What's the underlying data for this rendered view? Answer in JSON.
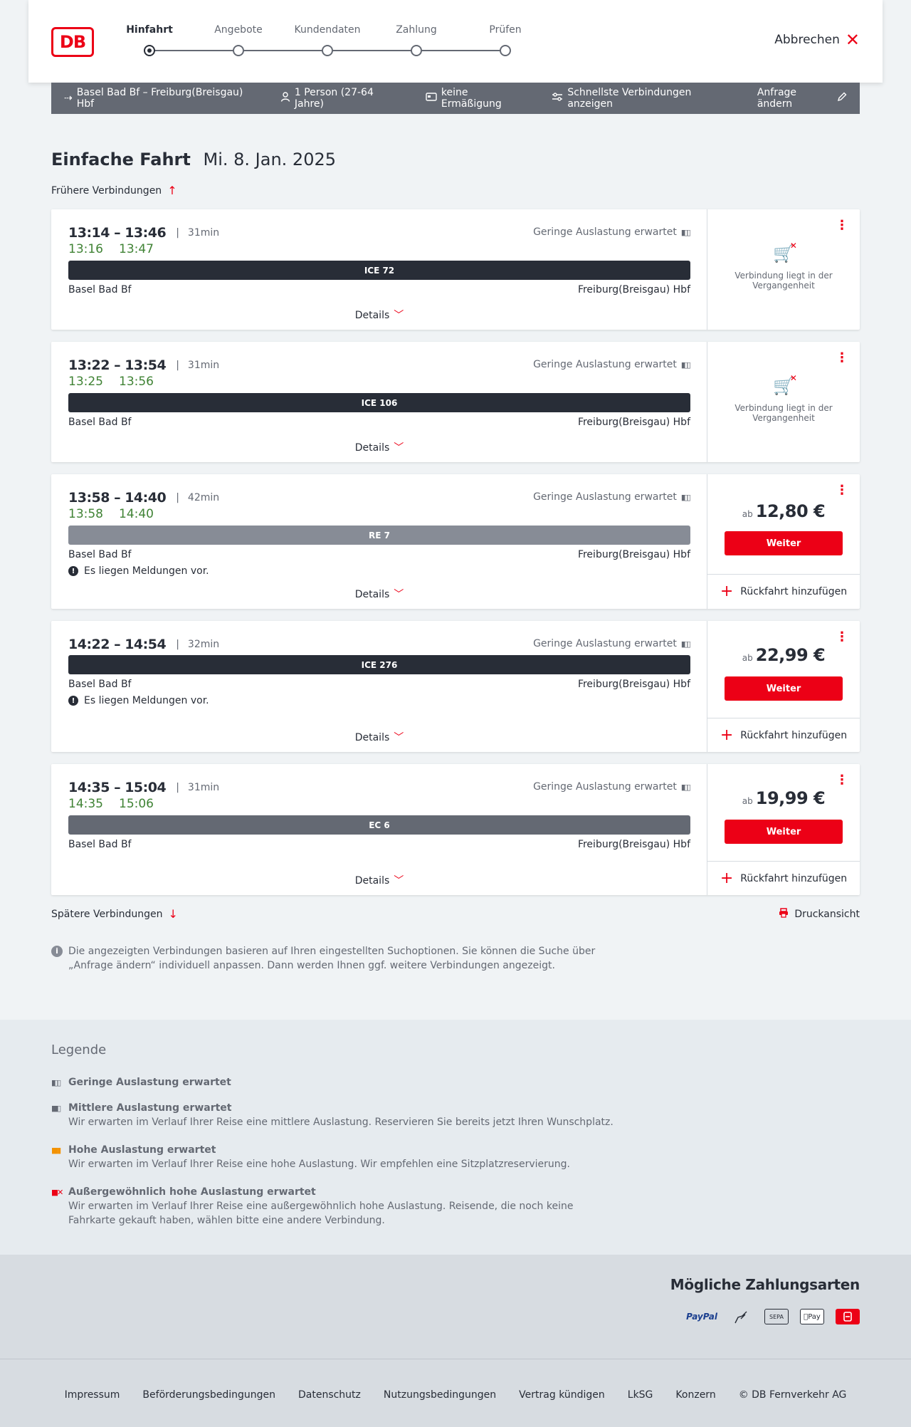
{
  "header": {
    "logo": "DB",
    "steps": [
      "Hinfahrt",
      "Angebote",
      "Kundendaten",
      "Zahlung",
      "Prüfen"
    ],
    "cancel_label": "Abbrechen"
  },
  "summary": {
    "route": "Basel Bad Bf – Freiburg(Breisgau) Hbf",
    "travellers": "1 Person (27-64 Jahre)",
    "discount": "keine Ermäßigung",
    "option": "Schnellste Verbindungen anzeigen",
    "edit_label": "Anfrage ändern"
  },
  "page": {
    "title": "Einfache Fahrt",
    "date": "Mi. 8. Jan. 2025",
    "earlier_label": "Frühere Verbindungen",
    "later_label": "Spätere Verbindungen",
    "print_label": "Druckansicht",
    "info_note": "Die angezeigten Verbindungen basieren auf Ihren eingestellten Suchoptionen. Sie können die Suche über „Anfrage ändern“ individuell anpassen. Dann werden Ihnen ggf. weitere Verbindungen angezeigt."
  },
  "common": {
    "occupancy": "Geringe Auslastung erwartet",
    "details_label": "Details",
    "past_text": "Verbindung liegt in der Vergangenheit",
    "price_prefix": "ab",
    "weiter_label": "Weiter",
    "return_label": "Rückfahrt hinzufügen",
    "message_text": "Es liegen Meldungen vor."
  },
  "connections": [
    {
      "times": "13:14 – 13:46",
      "duration": "31min",
      "rt_dep": "13:16",
      "rt_arr": "13:47",
      "train": "ICE 72",
      "train_color": "#282d37",
      "from": "Basel Bad Bf",
      "to": "Freiburg(Breisgau) Hbf",
      "price": ""
    },
    {
      "times": "13:22 – 13:54",
      "duration": "31min",
      "rt_dep": "13:25",
      "rt_arr": "13:56",
      "train": "ICE 106",
      "train_color": "#282d37",
      "from": "Basel Bad Bf",
      "to": "Freiburg(Breisgau) Hbf",
      "price": ""
    },
    {
      "times": "13:58 – 14:40",
      "duration": "42min",
      "rt_dep": "13:58",
      "rt_arr": "14:40",
      "train": "RE 7",
      "train_color": "#878c96",
      "from": "Basel Bad Bf",
      "to": "Freiburg(Breisgau) Hbf",
      "price": "12,80 €"
    },
    {
      "times": "14:22 – 14:54",
      "duration": "32min",
      "rt_dep": "",
      "rt_arr": "",
      "train": "ICE 276",
      "train_color": "#282d37",
      "from": "Basel Bad Bf",
      "to": "Freiburg(Breisgau) Hbf",
      "price": "22,99 €"
    },
    {
      "times": "14:35 – 15:04",
      "duration": "31min",
      "rt_dep": "14:35",
      "rt_arr": "15:06",
      "train": "EC 6",
      "train_color": "#646973",
      "from": "Basel Bad Bf",
      "to": "Freiburg(Breisgau) Hbf",
      "price": "19,99 €"
    }
  ],
  "legend": {
    "title": "Legende",
    "items": [
      {
        "title": "Geringe Auslastung erwartet",
        "desc": ""
      },
      {
        "title": "Mittlere Auslastung erwartet",
        "desc": "Wir erwarten im Verlauf Ihrer Reise eine mittlere Auslastung. Reservieren Sie bereits jetzt Ihren Wunschplatz."
      },
      {
        "title": "Hohe Auslastung erwartet",
        "desc": "Wir erwarten im Verlauf Ihrer Reise eine hohe Auslastung. Wir empfehlen eine Sitzplatzreservierung."
      },
      {
        "title": "Außergewöhnlich hohe Auslastung erwartet",
        "desc": "Wir erwarten im Verlauf Ihrer Reise eine außergewöhnlich hohe Auslastung. Reisende, die noch keine Fahrkarte gekauft haben, wählen bitte eine andere Verbindung."
      }
    ]
  },
  "payment": {
    "title": "Mögliche Zahlungsarten",
    "paypal": "PayPal",
    "sepa": "SEPA",
    "applepay": "Pay"
  },
  "footer": {
    "links": [
      "Impressum",
      "Beförderungsbedingungen",
      "Datenschutz",
      "Nutzungsbedingungen",
      "Vertrag kündigen",
      "LkSG",
      "Konzern"
    ],
    "copyright": "© DB Fernverkehr AG"
  },
  "colors": {
    "accent": "#ec0016",
    "realtime": "#408335",
    "dark": "#282d37",
    "grey": "#646973"
  }
}
